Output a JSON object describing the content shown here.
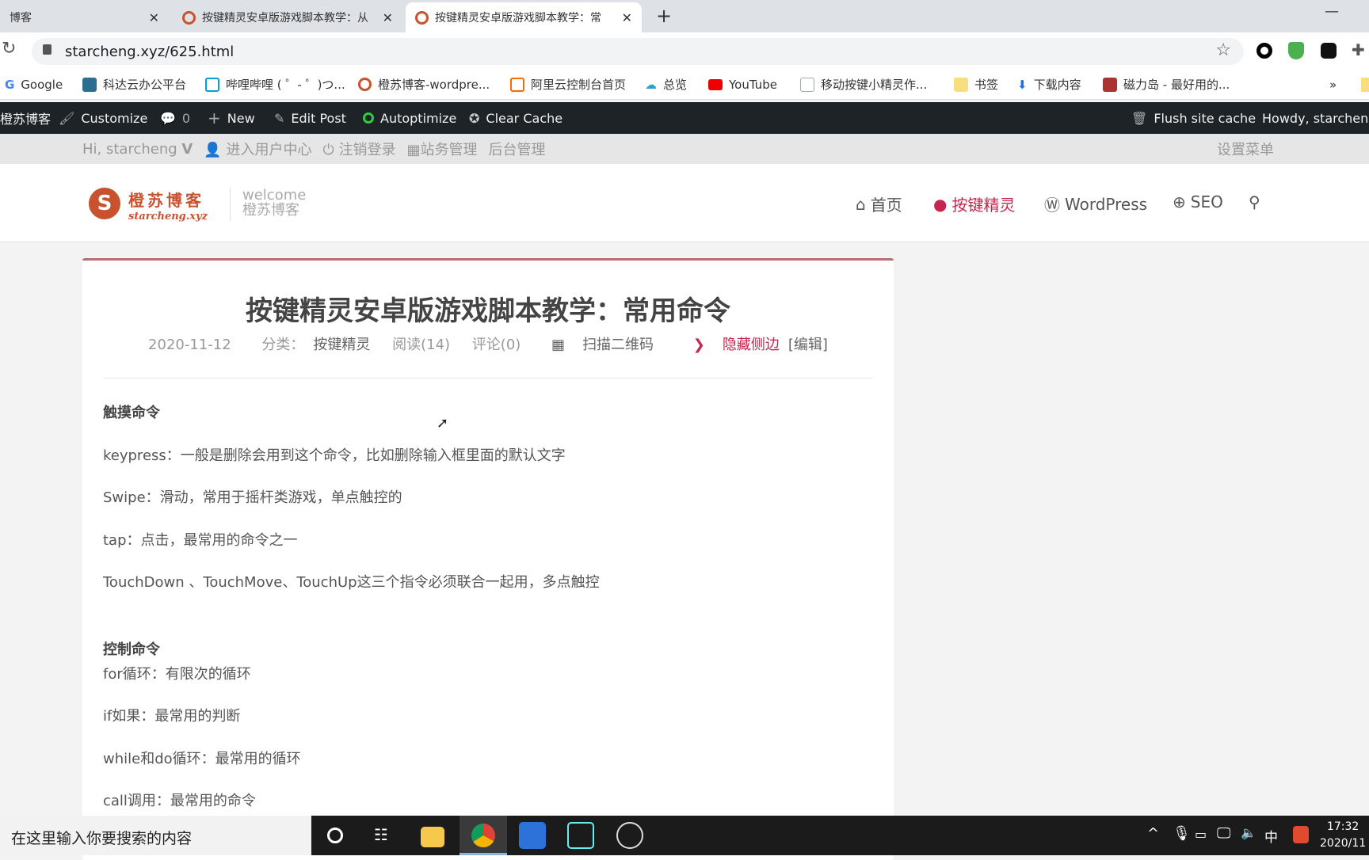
{
  "browser": {
    "tabs": [
      {
        "label": "博客"
      },
      {
        "label": "按键精灵安卓版游戏脚本教学：从"
      },
      {
        "label": "按键精灵安卓版游戏脚本教学：常"
      }
    ],
    "url": "starcheng.xyz/625.html",
    "bookmarks": [
      {
        "label": "Google"
      },
      {
        "label": "科达云办公平台"
      },
      {
        "label": "哔哩哔哩 ( ゜- ゜)つ..."
      },
      {
        "label": "橙苏博客-wordpre..."
      },
      {
        "label": "阿里云控制台首页"
      },
      {
        "label": "总览"
      },
      {
        "label": "YouTube"
      },
      {
        "label": "移动按键小精灵作..."
      },
      {
        "label": "书签"
      },
      {
        "label": "下载内容"
      },
      {
        "label": "磁力岛 - 最好用的..."
      }
    ],
    "more": "»"
  },
  "adminbar": {
    "site": "橙苏博客",
    "customize": "Customize",
    "comments": "0",
    "new": "New",
    "edit": "Edit Post",
    "autoptimize": "Autoptimize",
    "clear_cache": "Clear Cache",
    "flush": "Flush site cache",
    "howdy": "Howdy, starcheng"
  },
  "userbar": {
    "hi": "Hi, starcheng",
    "v": "V",
    "center": "进入用户中心",
    "logout": "注销登录",
    "site_admin": "站务管理",
    "backend": "后台管理",
    "menu": "设置菜单"
  },
  "header": {
    "logo_cn": "橙苏博客",
    "logo_en": "starcheng.xyz",
    "welcome": "welcome",
    "tagline": "橙苏博客",
    "nav": [
      {
        "label": "首页"
      },
      {
        "label": "按键精灵"
      },
      {
        "label": "WordPress"
      },
      {
        "label": "SEO"
      }
    ],
    "active_color": "#c7254e"
  },
  "article": {
    "title": "按键精灵安卓版游戏脚本教学：常用命令",
    "meta": {
      "date": "2020-11-12",
      "category_label": "分类：",
      "category": "按键精灵",
      "reads": "阅读(14)",
      "comments": "评论(0)",
      "qrcode": "扫描二维码",
      "hide_sidebar": "隐藏侧边",
      "edit": "[编辑]"
    },
    "paragraphs": [
      {
        "text": "触摸命令",
        "bold": true
      },
      {
        "text": "keypress：一般是删除会用到这个命令，比如删除输入框里面的默认文字"
      },
      {
        "text": "Swipe：滑动，常用于摇杆类游戏，单点触控的"
      },
      {
        "text": "tap：点击，最常用的命令之一"
      },
      {
        "text": "TouchDown 、TouchMove、TouchUp这三个指令必须联合一起用，多点触控"
      },
      {
        "text": "控制命令",
        "bold": true
      },
      {
        "text": "for循环：有限次的循环"
      },
      {
        "text": "if如果：最常用的判断"
      },
      {
        "text": "while和do循环：最常用的循环"
      },
      {
        "text": "call调用：最常用的命令"
      }
    ]
  },
  "taskbar": {
    "search_placeholder": "在这里输入你要搜索的内容",
    "ime": "中",
    "time": "17:32",
    "date": "2020/11"
  }
}
